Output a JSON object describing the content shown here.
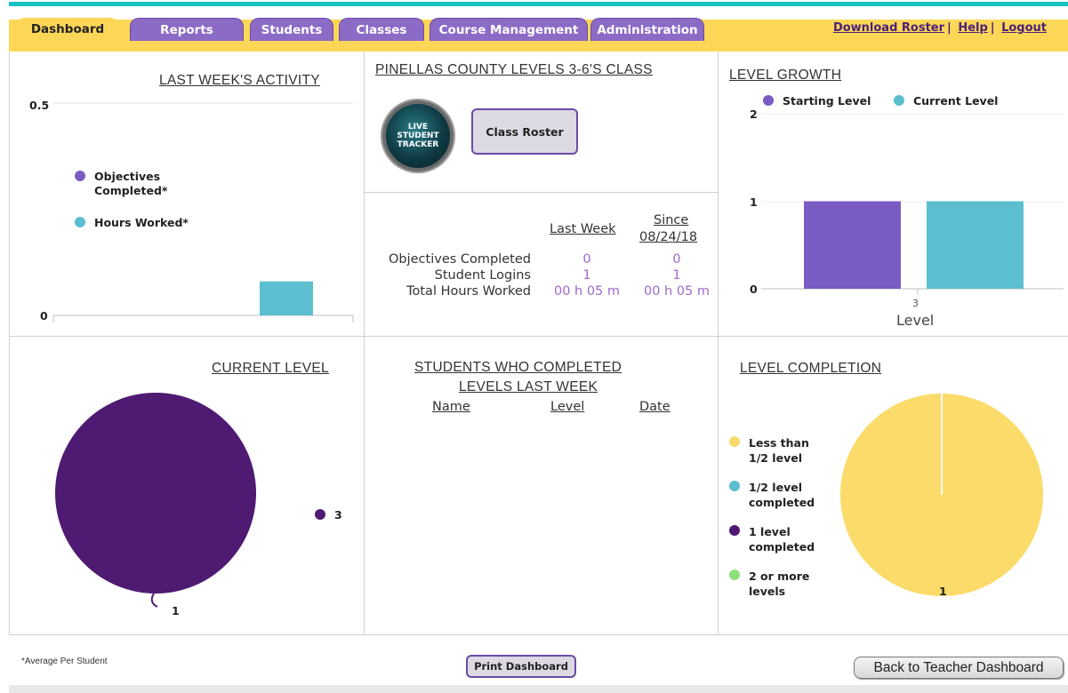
{
  "nav": {
    "tabs": [
      {
        "label": "Dashboard",
        "active": true
      },
      {
        "label": "Reports"
      },
      {
        "label": "Students"
      },
      {
        "label": "Classes"
      },
      {
        "label": "Course Management"
      },
      {
        "label": "Administration"
      }
    ],
    "links": {
      "download_roster": "Download Roster",
      "help": "Help",
      "logout": "Logout",
      "sep": "|"
    }
  },
  "activity": {
    "title": "LAST WEEK'S ACTIVITY",
    "y_max_label": "0.5",
    "y_min_label": "0",
    "legend": [
      {
        "label": "Objectives Completed*",
        "color": "#7b5cc4"
      },
      {
        "label": "Hours Worked*",
        "color": "#5bbfcf"
      }
    ]
  },
  "class_panel": {
    "title": "PINELLAS COUNTY LEVELS 3-6'S CLASS",
    "tracker_logo_text": [
      "LIVE",
      "STUDENT",
      "TRACKER"
    ],
    "roster_button": "Class Roster",
    "col_last_week": "Last Week",
    "col_since": "Since",
    "col_since_date": "08/24/18",
    "rows": [
      {
        "label": "Objectives Completed",
        "last_week": "0",
        "since": "0"
      },
      {
        "label": "Student Logins",
        "last_week": "1",
        "since": "1"
      },
      {
        "label": "Total Hours Worked",
        "last_week": "00 h 05 m",
        "since": "00 h 05 m"
      }
    ]
  },
  "level_growth": {
    "title": "LEVEL GROWTH",
    "legend": [
      {
        "label": "Starting Level",
        "color": "#7b5cc4"
      },
      {
        "label": "Current Level",
        "color": "#5bbfcf"
      }
    ],
    "xlabel": "Level",
    "y_ticks": [
      "2",
      "1",
      "0"
    ]
  },
  "current_level": {
    "title": "CURRENT LEVEL",
    "legend_label": "3",
    "slice_label": "1",
    "color": "#4e1a72"
  },
  "completed": {
    "title_line1": "STUDENTS WHO COMPLETED",
    "title_line2": "LEVELS LAST WEEK",
    "col_name": "Name",
    "col_level": "Level",
    "col_date": "Date"
  },
  "level_completion": {
    "title": "LEVEL COMPLETION",
    "legend": [
      {
        "label": "Less than 1/2 level",
        "color": "#f9d96a"
      },
      {
        "label": "1/2 level completed",
        "color": "#5bbfcf"
      },
      {
        "label": "1 level completed",
        "color": "#4e1a72"
      },
      {
        "label": "2 or more levels",
        "color": "#8fe07a"
      }
    ],
    "slice_label": "1"
  },
  "footer": {
    "note": "*Average Per Student",
    "print_button": "Print Dashboard",
    "back_button": "Back to Teacher Dashboard"
  },
  "chart_data": [
    {
      "type": "bar",
      "title": "LAST WEEK'S ACTIVITY",
      "categories": [
        ""
      ],
      "series": [
        {
          "name": "Objectives Completed*",
          "values": [
            0
          ]
        },
        {
          "name": "Hours Worked*",
          "values": [
            0.08
          ]
        }
      ],
      "ylim": [
        0,
        0.5
      ],
      "colors": [
        "#7b5cc4",
        "#5bbfcf"
      ]
    },
    {
      "type": "bar",
      "title": "LEVEL GROWTH",
      "categories": [
        "3"
      ],
      "xlabel": "Level",
      "series": [
        {
          "name": "Starting Level",
          "values": [
            1
          ]
        },
        {
          "name": "Current Level",
          "values": [
            1
          ]
        }
      ],
      "ylim": [
        0,
        2
      ],
      "colors": [
        "#7b5cc4",
        "#5bbfcf"
      ]
    },
    {
      "type": "pie",
      "title": "CURRENT LEVEL",
      "categories": [
        "3"
      ],
      "values": [
        1
      ],
      "colors": [
        "#4e1a72"
      ]
    },
    {
      "type": "pie",
      "title": "LEVEL COMPLETION",
      "categories": [
        "Less than 1/2 level",
        "1/2 level completed",
        "1 level completed",
        "2 or more levels"
      ],
      "values": [
        1,
        0,
        0,
        0
      ],
      "colors": [
        "#f9d96a",
        "#5bbfcf",
        "#4e1a72",
        "#8fe07a"
      ]
    }
  ]
}
